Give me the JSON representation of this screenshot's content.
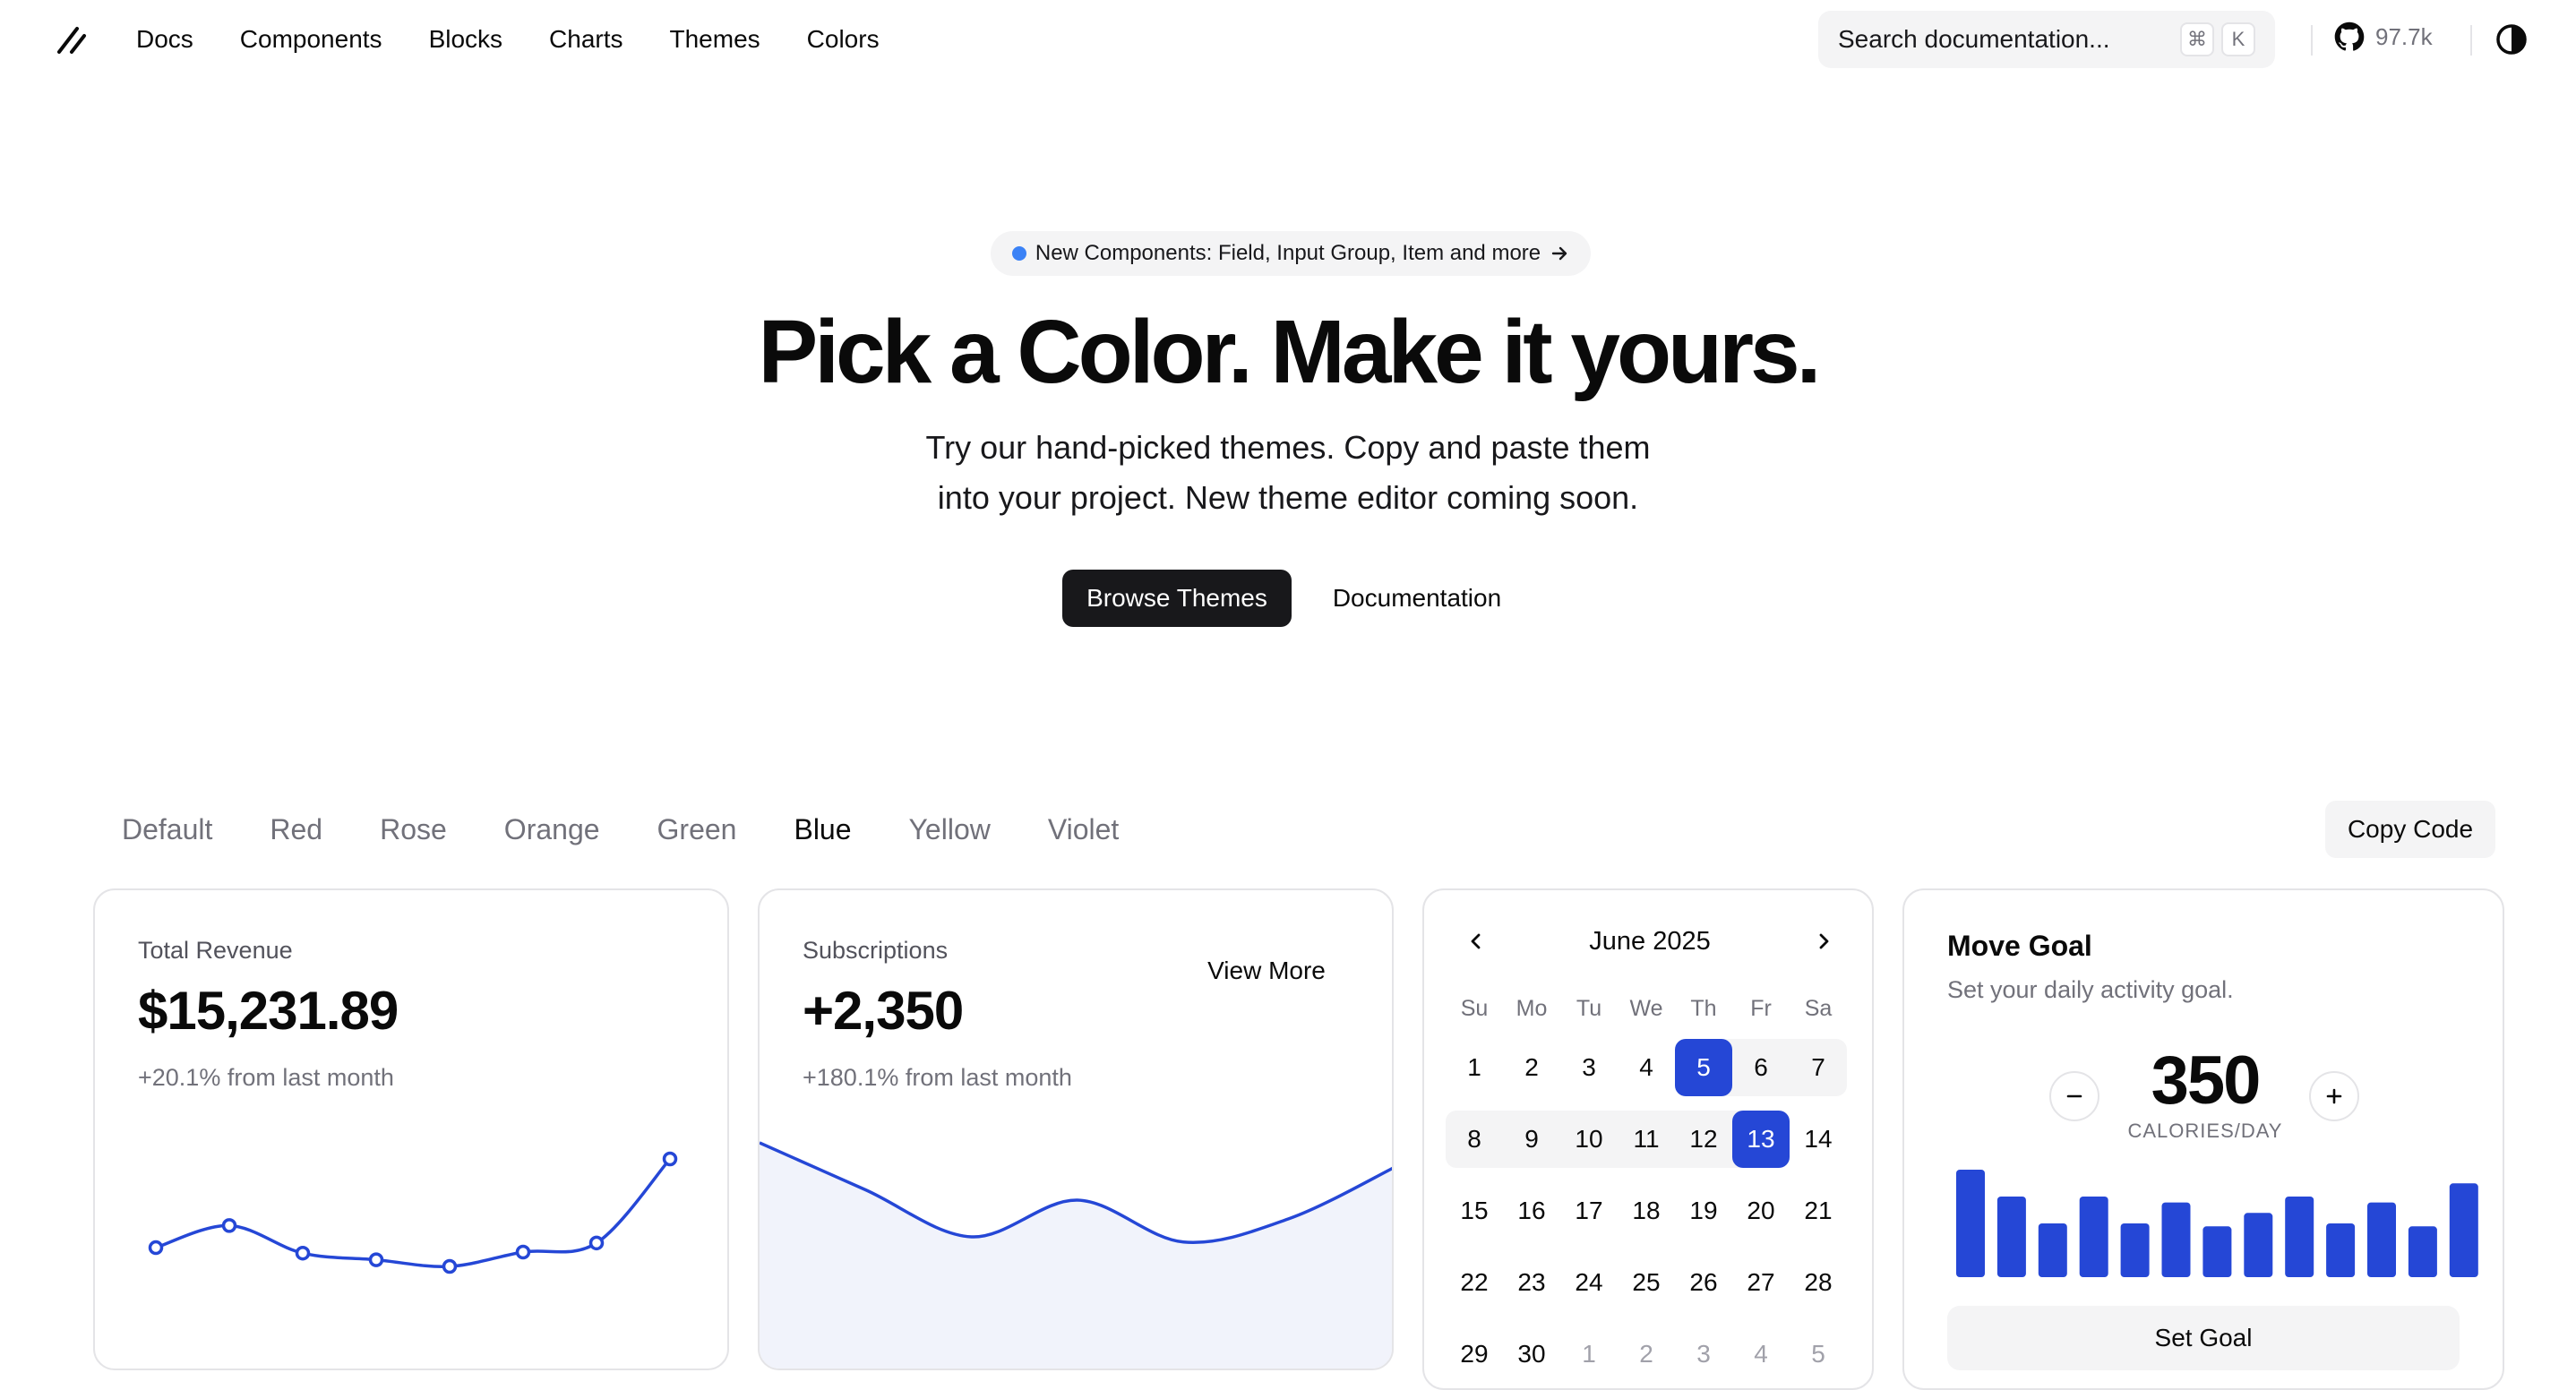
{
  "header": {
    "nav": [
      "Docs",
      "Components",
      "Blocks",
      "Charts",
      "Themes",
      "Colors"
    ],
    "search": {
      "label": "Search documentation...",
      "kbd1": "⌘",
      "kbd2": "K"
    },
    "github_stars": "97.7k"
  },
  "hero": {
    "announcement": "New Components: Field, Input Group, Item and more",
    "title": "Pick a Color. Make it yours.",
    "subtitle_line1": "Try our hand-picked themes. Copy and paste them",
    "subtitle_line2": "into your project. New theme editor coming soon.",
    "primary_button": "Browse Themes",
    "secondary_button": "Documentation"
  },
  "color_tabs": {
    "items": [
      "Default",
      "Red",
      "Rose",
      "Orange",
      "Green",
      "Blue",
      "Yellow",
      "Violet"
    ],
    "active": "Blue",
    "copy_button": "Copy Code"
  },
  "accent_color": "#2547d6",
  "revenue": {
    "label": "Total Revenue",
    "value": "$15,231.89",
    "delta": "+20.1% from last month"
  },
  "subscriptions": {
    "label": "Subscriptions",
    "value": "+2,350",
    "delta": "+180.1% from last month",
    "view_more": "View More"
  },
  "calendar": {
    "month": "June 2025",
    "weekdays": [
      "Su",
      "Mo",
      "Tu",
      "We",
      "Th",
      "Fr",
      "Sa"
    ],
    "weeks": [
      [
        "1",
        "2",
        "3",
        "4",
        "5",
        "6",
        "7"
      ],
      [
        "8",
        "9",
        "10",
        "11",
        "12",
        "13",
        "14"
      ],
      [
        "15",
        "16",
        "17",
        "18",
        "19",
        "20",
        "21"
      ],
      [
        "22",
        "23",
        "24",
        "25",
        "26",
        "27",
        "28"
      ],
      [
        "29",
        "30",
        "1",
        "2",
        "3",
        "4",
        "5"
      ]
    ],
    "selected": [
      "5",
      "13"
    ]
  },
  "move_goal": {
    "title": "Move Goal",
    "description": "Set your daily activity goal.",
    "value": "350",
    "unit": "CALORIES/DAY",
    "button": "Set Goal",
    "bars": [
      400,
      300,
      200,
      300,
      200,
      278,
      189,
      239,
      300,
      200,
      278,
      189,
      349
    ]
  },
  "chart_data": [
    {
      "type": "line",
      "x": [
        1,
        2,
        3,
        4,
        5,
        6,
        7,
        8
      ],
      "series": [
        {
          "values": [
            10400,
            14405,
            9400,
            8200,
            7000,
            9600,
            11244,
            26475
          ]
        }
      ]
    },
    {
      "type": "area",
      "x": [
        1,
        2,
        3,
        4,
        5,
        6,
        7
      ],
      "series": [
        {
          "values": [
            4000,
            3000,
            2000,
            2780,
            1890,
            2390,
            3490
          ]
        }
      ]
    }
  ]
}
